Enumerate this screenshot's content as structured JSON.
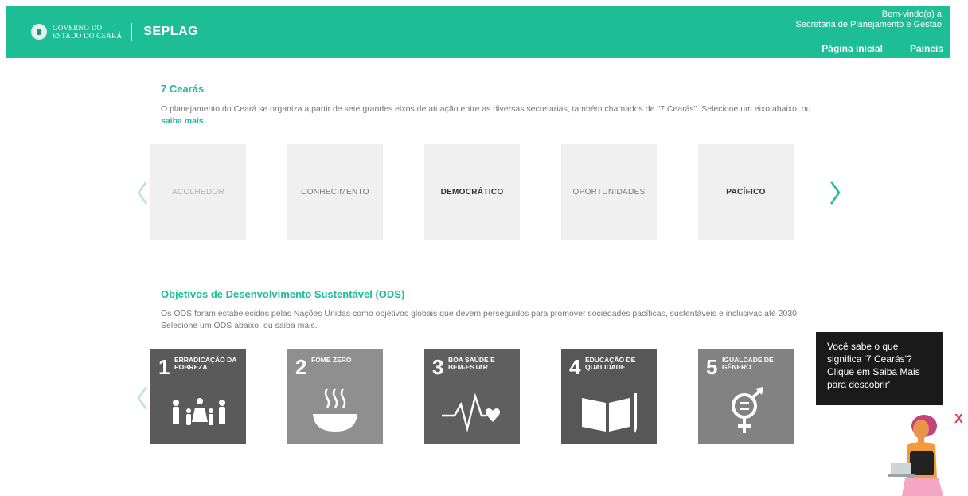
{
  "header": {
    "gov_line1": "GOVERNO DO",
    "gov_line2": "ESTADO DO CEARÁ",
    "brand": "SEPLAG",
    "welcome_line1": "Bem-vindo(a) à",
    "welcome_line2": "Secretaria de Planejamento e Gestão",
    "nav": {
      "home": "Página inicial",
      "panels": "Paineis"
    }
  },
  "cearas": {
    "title": "7 Cearás",
    "desc_prefix": "O planejamento do Ceará se organiza a partir de sete grandes eixos de atuação entre as diversas secretarias, também chamados de \"7 Cearás\". Selecione um eixo abaixo, ou ",
    "desc_link": "saiba mais.",
    "cards": [
      "ACOLHEDOR",
      "CONHECIMENTO",
      "DEMOCRÁTICO",
      "OPORTUNIDADES",
      "PACÍFICO"
    ]
  },
  "ods": {
    "title": "Objetivos de Desenvolvimento Sustentável (ODS)",
    "desc": "Os ODS foram estabelecidos pelas Nações Unidas como objetivos globais que devem perseguidos para promover sociedades pacíficas, sustentáveis e inclusivas até 2030. Selecione um ODS abaixo, ou saiba mais.",
    "cards": [
      {
        "num": "1",
        "label": "Erradicação da pobreza",
        "icon": "family-icon",
        "color": "#5a5a5a"
      },
      {
        "num": "2",
        "label": "Fome zero",
        "icon": "bowl-icon",
        "color": "#8f8f8f"
      },
      {
        "num": "3",
        "label": "Boa saúde e bem-estar",
        "icon": "heartbeat-icon",
        "color": "#5f5f5f"
      },
      {
        "num": "4",
        "label": "Educação de qualidade",
        "icon": "book-icon",
        "color": "#575757"
      },
      {
        "num": "5",
        "label": "Igualdade de gênero",
        "icon": "gender-equality-icon",
        "color": "#828282"
      }
    ]
  },
  "tooltip": {
    "text": "Você sabe o que significa '7 Cearás'? Clique em Saiba Mais para descobrir'",
    "close": "X"
  },
  "colors": {
    "accent": "#1dbd96",
    "arrow": "#1dbd96",
    "arrow_faded": "#b7e5d9"
  }
}
